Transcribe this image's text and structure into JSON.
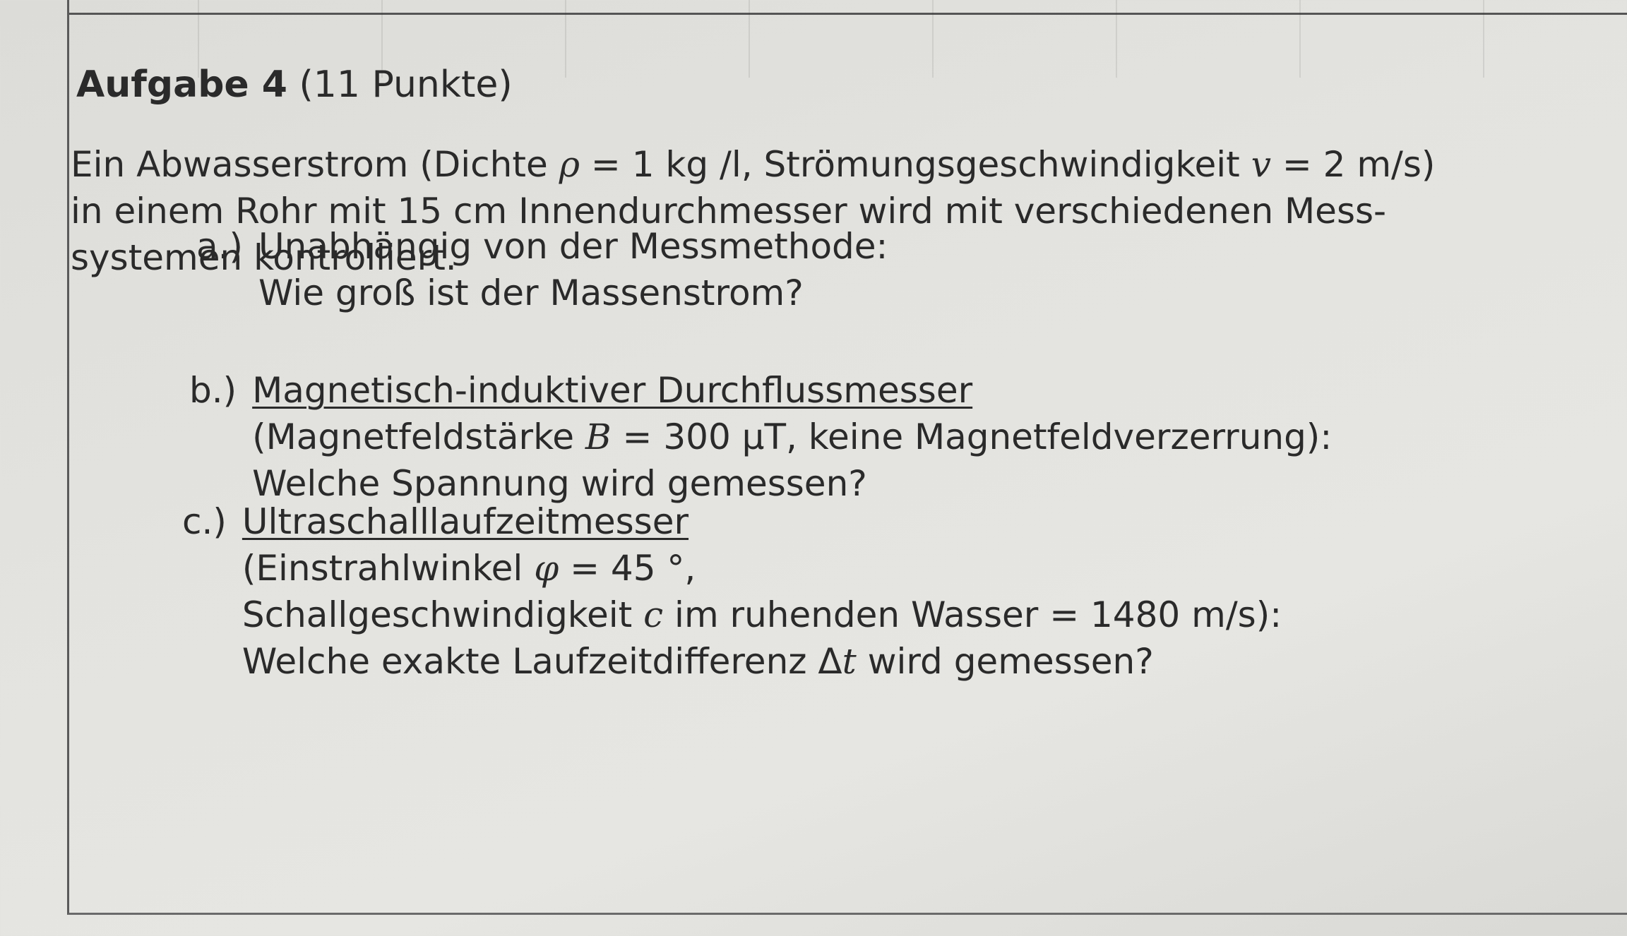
{
  "task": {
    "title_bold": "Aufgabe 4",
    "title_points": "(11 Punkte)"
  },
  "intro": {
    "line1_a": "Ein Abwasserstrom (Dichte ",
    "rho_symbol": "ρ",
    "line1_b": " = 1 kg /l, Strömungsgeschwindigkeit ",
    "v_symbol": "v",
    "line1_c": " = 2 m/s)",
    "line2": "in einem Rohr mit 15 cm Innendurchmesser wird mit verschiedenen Mess-",
    "line3": "systemen kontrolliert."
  },
  "part_a": {
    "label": "a.)",
    "line1": "Unabhängig von der Messmethode:",
    "line2": "Wie groß ist der Massenstrom?"
  },
  "part_b": {
    "label": "b.)",
    "heading": "Magnetisch-induktiver Durchflussmesser",
    "line2_a": "(Magnetfeldstärke ",
    "B_symbol": "B",
    "line2_b": " = 300 μT, keine Magnetfeldverzerrung):",
    "line3": "Welche Spannung wird gemessen?"
  },
  "part_c": {
    "label": "c.)",
    "heading": "Ultraschalllaufzeitmesser",
    "line2_a": "(Einstrahlwinkel ",
    "phi_symbol": "φ",
    "line2_b": " = 45 °,",
    "line3_a": "Schallgeschwindigkeit ",
    "c_symbol": "c",
    "line3_b": " im ruhenden Wasser = 1480 m/s):",
    "line4_a": "Welche exakte Laufzeitdifferenz Δ",
    "t_symbol": "t",
    "line4_b": " wird gemessen?"
  }
}
